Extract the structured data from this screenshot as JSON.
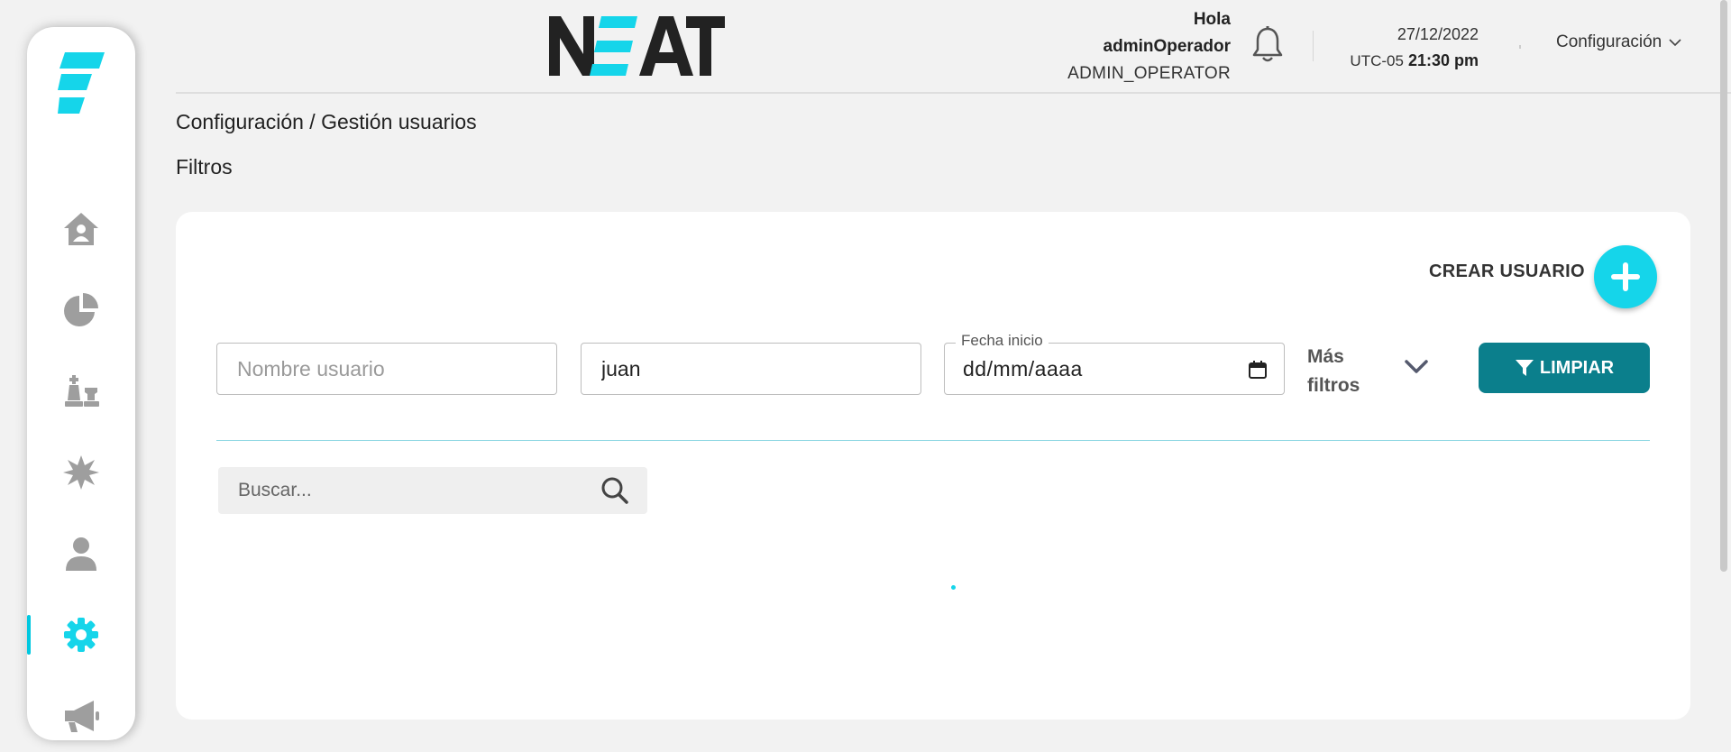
{
  "header": {
    "brand": "NEAT",
    "greeting": "Hola",
    "username": "adminOperador",
    "role": "ADMIN_OPERATOR",
    "date": "27/12/2022",
    "timezone": "UTC-05",
    "time": "21:30 pm",
    "menu_label": "Configuración"
  },
  "sidebar": {
    "items": [
      {
        "icon": "home-icon"
      },
      {
        "icon": "pie-chart-icon"
      },
      {
        "icon": "chess-icon"
      },
      {
        "icon": "burst-icon"
      },
      {
        "icon": "user-icon"
      },
      {
        "icon": "gear-icon",
        "active": true
      },
      {
        "icon": "megaphone-icon"
      }
    ]
  },
  "breadcrumb": "Configuración / Gestión usuarios",
  "filters": {
    "title": "Filtros",
    "create_label": "CREAR USUARIO",
    "username_placeholder": "Nombre usuario",
    "name_value": "juan",
    "start_date_label": "Fecha inicio",
    "start_date_value": "dd/mm/aaaa",
    "more_filters_line1": "Más",
    "more_filters_line2": "filtros",
    "clear_label": "LIMPIAR"
  },
  "search": {
    "placeholder": "Buscar..."
  },
  "colors": {
    "accent": "#15d5ea",
    "primary_button": "#0b7f8c",
    "sidebar_icon": "#9e9e9e"
  }
}
